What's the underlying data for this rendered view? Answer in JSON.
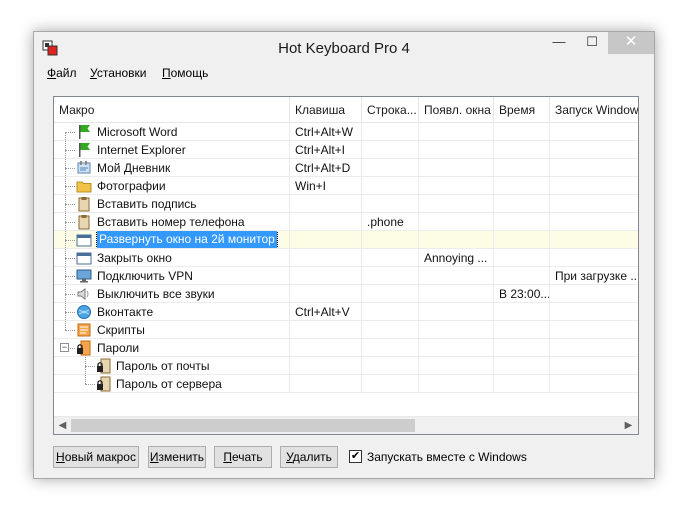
{
  "window": {
    "title": "Hot Keyboard Pro 4",
    "btn_min": "—",
    "btn_max": "☐",
    "btn_close": "✕"
  },
  "menu": [
    {
      "pre": "",
      "u": "Ф",
      "post": "айл"
    },
    {
      "pre": "",
      "u": "У",
      "post": "становки"
    },
    {
      "pre": "",
      "u": "П",
      "post": "омощь"
    }
  ],
  "columns": [
    "Макро",
    "Клавиша",
    "Строка...",
    "Появл. окна",
    "Время",
    "Запуск Windows"
  ],
  "rows": [
    {
      "name": "Microsoft Word",
      "icon": "green-flag-icon",
      "key": "Ctrl+Alt+W",
      "str": "",
      "win": "",
      "time": "",
      "startup": ""
    },
    {
      "name": "Internet Explorer",
      "icon": "green-flag-icon",
      "key": "Ctrl+Alt+I",
      "str": "",
      "win": "",
      "time": "",
      "startup": ""
    },
    {
      "name": "Мой Дневник",
      "icon": "notebook-icon",
      "key": "Ctrl+Alt+D",
      "str": "",
      "win": "",
      "time": "",
      "startup": ""
    },
    {
      "name": "Фотографии",
      "icon": "folder-icon",
      "key": "Win+I",
      "str": "",
      "win": "",
      "time": "",
      "startup": ""
    },
    {
      "name": "Вставить подпись",
      "icon": "clipboard-icon",
      "key": "",
      "str": "",
      "win": "",
      "time": "",
      "startup": ""
    },
    {
      "name": "Вставить номер телефона",
      "icon": "clipboard-icon",
      "key": "",
      "str": ".phone",
      "win": "",
      "time": "",
      "startup": ""
    },
    {
      "name": "Развернуть окно на 2й монитор",
      "icon": "window-icon",
      "key": "",
      "str": "",
      "win": "",
      "time": "",
      "startup": "",
      "selected": true
    },
    {
      "name": "Закрыть окно",
      "icon": "window-icon",
      "key": "",
      "str": "",
      "win": "Annoying ...",
      "time": "",
      "startup": ""
    },
    {
      "name": "Подключить VPN",
      "icon": "monitor-icon",
      "key": "",
      "str": "",
      "win": "",
      "time": "",
      "startup": "При загрузке ..."
    },
    {
      "name": "Выключить все звуки",
      "icon": "speaker-icon",
      "key": "",
      "str": "",
      "win": "",
      "time": "В 23:00...",
      "startup": ""
    },
    {
      "name": "Вконтакте",
      "icon": "globe-icon",
      "key": "Ctrl+Alt+V",
      "str": "",
      "win": "",
      "time": "",
      "startup": ""
    },
    {
      "name": "Скрипты",
      "icon": "script-icon",
      "key": "",
      "str": "",
      "win": "",
      "time": "",
      "startup": ""
    },
    {
      "name": "Пароли",
      "icon": "lock-folder-icon",
      "key": "",
      "str": "",
      "win": "",
      "time": "",
      "startup": "",
      "group": true
    },
    {
      "name": "Пароль от почты",
      "icon": "lock-clipboard-icon",
      "key": "",
      "str": "",
      "win": "",
      "time": "",
      "startup": "",
      "child": true
    },
    {
      "name": "Пароль от сервера",
      "icon": "lock-clipboard-icon",
      "key": "",
      "str": "",
      "win": "",
      "time": "",
      "startup": "",
      "child": true
    }
  ],
  "buttons": [
    {
      "u": "Н",
      "post": "овый макрос"
    },
    {
      "u": "И",
      "post": "зменить"
    },
    {
      "u": "П",
      "post": "ечать"
    },
    {
      "u": "У",
      "post": "далить"
    }
  ],
  "autostart": {
    "label": "Запускать вместе с Windows",
    "checked": true,
    "mark": "✔"
  },
  "colors": {
    "accent": "#3399ff",
    "selected_row": "#fdfde6",
    "flag": "#33aa22",
    "folder": "#f0c24a",
    "close_button": "#c7c7c7"
  }
}
